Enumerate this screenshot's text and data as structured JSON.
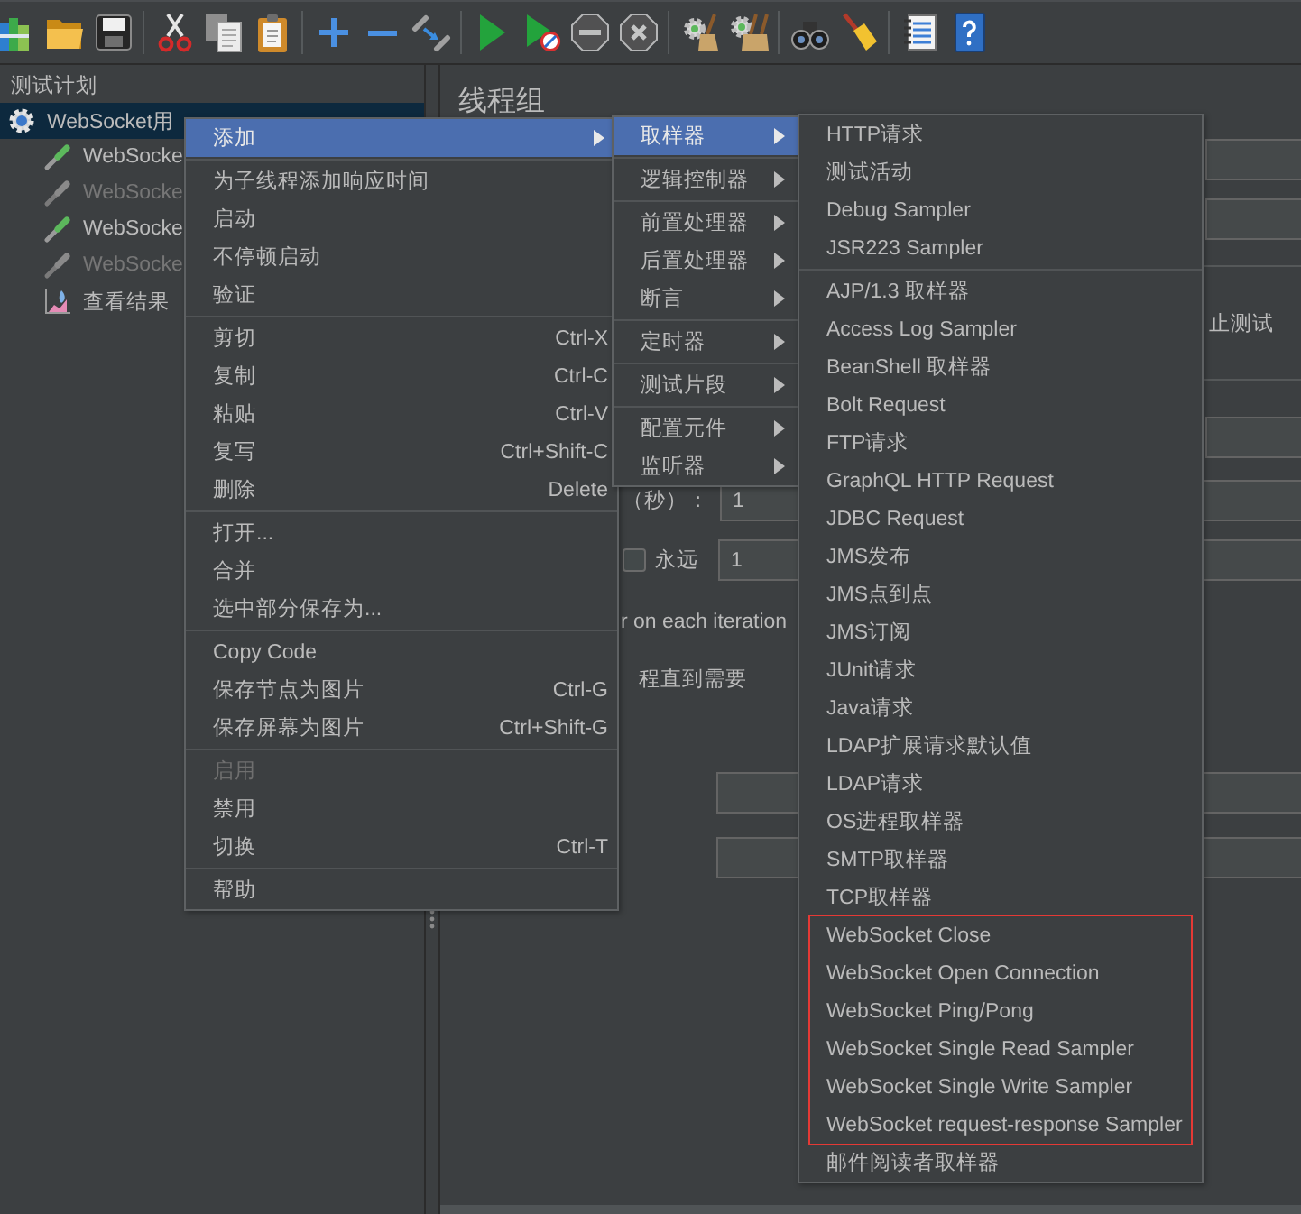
{
  "toolbar": {
    "groups": [
      [
        {
          "kind": "templates",
          "disabled": false
        },
        {
          "kind": "open",
          "disabled": false
        },
        {
          "kind": "save",
          "disabled": false
        }
      ],
      [
        {
          "kind": "cut",
          "disabled": false
        },
        {
          "kind": "copy",
          "disabled": false
        },
        {
          "kind": "paste",
          "disabled": false
        }
      ],
      [
        {
          "kind": "expand",
          "disabled": false
        },
        {
          "kind": "collapse",
          "disabled": false
        },
        {
          "kind": "toggle",
          "disabled": false
        }
      ],
      [
        {
          "kind": "start",
          "disabled": false
        },
        {
          "kind": "start_no_pauses",
          "disabled": false
        },
        {
          "kind": "stop",
          "disabled": true
        },
        {
          "kind": "shutdown",
          "disabled": true
        }
      ],
      [
        {
          "kind": "clear",
          "disabled": false
        },
        {
          "kind": "clear_all",
          "disabled": false
        }
      ],
      [
        {
          "kind": "search",
          "disabled": false
        },
        {
          "kind": "reset_search",
          "disabled": false
        }
      ],
      [
        {
          "kind": "function_helper",
          "disabled": false
        },
        {
          "kind": "help",
          "disabled": false
        }
      ]
    ]
  },
  "tree": {
    "items": [
      {
        "kind": "test_plan",
        "label": "测试计划",
        "selected": false,
        "disabled": false,
        "children": [
          {
            "kind": "thread_group",
            "label": "WebSocket用",
            "selected": true,
            "disabled": false,
            "children": [
              {
                "kind": "sampler",
                "label": "WebSocke",
                "selected": false,
                "disabled": false
              },
              {
                "kind": "sampler",
                "label": "WebSocke",
                "selected": false,
                "disabled": true
              },
              {
                "kind": "sampler",
                "label": "WebSocke",
                "selected": false,
                "disabled": false
              },
              {
                "kind": "sampler",
                "label": "WebSocke",
                "selected": false,
                "disabled": true
              },
              {
                "kind": "listener",
                "label": "查看结果",
                "selected": false,
                "disabled": false
              }
            ]
          }
        ]
      }
    ]
  },
  "panel": {
    "title": "线程组",
    "rows": [
      {
        "kind": "field"
      },
      {
        "kind": "field"
      },
      {
        "kind": "option",
        "text": "止测试"
      },
      {
        "kind": "field"
      },
      {
        "kind": "field",
        "label": "（秒）：",
        "value": "1"
      },
      {
        "kind": "loop",
        "label": "永远",
        "checked": false,
        "value": "1"
      },
      {
        "kind": "note",
        "text": "r on each iteration"
      },
      {
        "kind": "note",
        "text": "程直到需要"
      },
      {
        "kind": "field"
      },
      {
        "kind": "field"
      }
    ]
  },
  "menus": [
    {
      "sections": [
        [
          {
            "label": "添加",
            "submenu": true,
            "selected": true,
            "disabled": false
          }
        ],
        [
          {
            "label": "为子线程添加响应时间",
            "submenu": false,
            "selected": false,
            "disabled": false
          },
          {
            "label": "启动",
            "submenu": false,
            "selected": false,
            "disabled": false
          },
          {
            "label": "不停顿启动",
            "submenu": false,
            "selected": false,
            "disabled": false
          },
          {
            "label": "验证",
            "submenu": false,
            "selected": false,
            "disabled": false
          }
        ],
        [
          {
            "label": "剪切",
            "shortcut": "Ctrl-X",
            "submenu": false,
            "selected": false,
            "disabled": false
          },
          {
            "label": "复制",
            "shortcut": "Ctrl-C",
            "submenu": false,
            "selected": false,
            "disabled": false
          },
          {
            "label": "粘贴",
            "shortcut": "Ctrl-V",
            "submenu": false,
            "selected": false,
            "disabled": false
          },
          {
            "label": "复写",
            "shortcut": "Ctrl+Shift-C",
            "submenu": false,
            "selected": false,
            "disabled": false
          },
          {
            "label": "删除",
            "shortcut": "Delete",
            "submenu": false,
            "selected": false,
            "disabled": false
          }
        ],
        [
          {
            "label": "打开...",
            "submenu": false,
            "selected": false,
            "disabled": false
          },
          {
            "label": "合并",
            "submenu": false,
            "selected": false,
            "disabled": false
          },
          {
            "label": "选中部分保存为...",
            "submenu": false,
            "selected": false,
            "disabled": false
          }
        ],
        [
          {
            "label": "Copy Code",
            "submenu": false,
            "selected": false,
            "disabled": false
          },
          {
            "label": "保存节点为图片",
            "shortcut": "Ctrl-G",
            "submenu": false,
            "selected": false,
            "disabled": false
          },
          {
            "label": "保存屏幕为图片",
            "shortcut": "Ctrl+Shift-G",
            "submenu": false,
            "selected": false,
            "disabled": false
          }
        ],
        [
          {
            "label": "启用",
            "submenu": false,
            "selected": false,
            "disabled": true
          },
          {
            "label": "禁用",
            "submenu": false,
            "selected": false,
            "disabled": false
          },
          {
            "label": "切换",
            "shortcut": "Ctrl-T",
            "submenu": false,
            "selected": false,
            "disabled": false
          }
        ],
        [
          {
            "label": "帮助",
            "submenu": false,
            "selected": false,
            "disabled": false
          }
        ]
      ]
    },
    {
      "sections": [
        [
          {
            "label": "取样器",
            "submenu": true,
            "selected": true
          }
        ],
        [
          {
            "label": "逻辑控制器",
            "submenu": true,
            "selected": false
          }
        ],
        [
          {
            "label": "前置处理器",
            "submenu": true,
            "selected": false
          },
          {
            "label": "后置处理器",
            "submenu": true,
            "selected": false
          },
          {
            "label": "断言",
            "submenu": true,
            "selected": false
          }
        ],
        [
          {
            "label": "定时器",
            "submenu": true,
            "selected": false
          }
        ],
        [
          {
            "label": "测试片段",
            "submenu": true,
            "selected": false
          }
        ],
        [
          {
            "label": "配置元件",
            "submenu": true,
            "selected": false
          },
          {
            "label": "监听器",
            "submenu": true,
            "selected": false
          }
        ]
      ]
    },
    {
      "sections": [
        [
          {
            "label": "HTTP请求",
            "highlighted": false
          },
          {
            "label": "测试活动",
            "highlighted": false
          },
          {
            "label": "Debug Sampler",
            "highlighted": false
          },
          {
            "label": "JSR223 Sampler",
            "highlighted": false
          }
        ],
        [
          {
            "label": "AJP/1.3 取样器",
            "highlighted": false
          },
          {
            "label": "Access Log Sampler",
            "highlighted": false
          },
          {
            "label": "BeanShell 取样器",
            "highlighted": false
          },
          {
            "label": "Bolt Request",
            "highlighted": false
          },
          {
            "label": "FTP请求",
            "highlighted": false
          },
          {
            "label": "GraphQL HTTP Request",
            "highlighted": false
          },
          {
            "label": "JDBC Request",
            "highlighted": false
          },
          {
            "label": "JMS发布",
            "highlighted": false
          },
          {
            "label": "JMS点到点",
            "highlighted": false
          },
          {
            "label": "JMS订阅",
            "highlighted": false
          },
          {
            "label": "JUnit请求",
            "highlighted": false
          },
          {
            "label": "Java请求",
            "highlighted": false
          },
          {
            "label": "LDAP扩展请求默认值",
            "highlighted": false
          },
          {
            "label": "LDAP请求",
            "highlighted": false
          },
          {
            "label": "OS进程取样器",
            "highlighted": false
          },
          {
            "label": "SMTP取样器",
            "highlighted": false
          },
          {
            "label": "TCP取样器",
            "highlighted": false
          },
          {
            "label": "WebSocket Close",
            "highlighted": true
          },
          {
            "label": "WebSocket Open Connection",
            "highlighted": true
          },
          {
            "label": "WebSocket Ping/Pong",
            "highlighted": true
          },
          {
            "label": "WebSocket Single Read Sampler",
            "highlighted": true
          },
          {
            "label": "WebSocket Single Write Sampler",
            "highlighted": true
          },
          {
            "label": "WebSocket request-response Sampler",
            "highlighted": true
          },
          {
            "label": "邮件阅读者取样器",
            "highlighted": false
          }
        ]
      ]
    }
  ]
}
